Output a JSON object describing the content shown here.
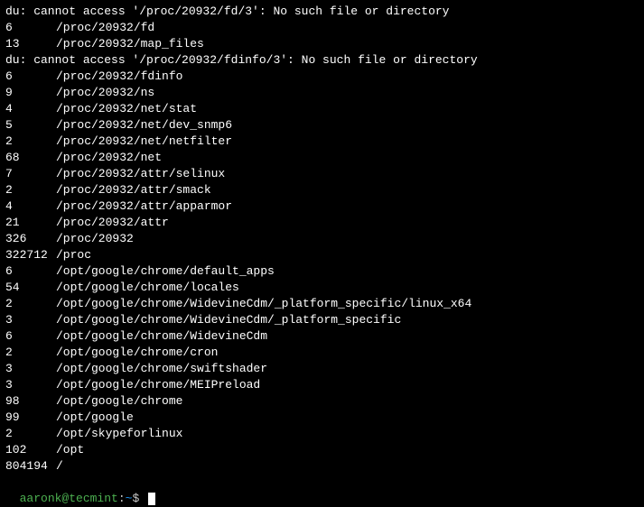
{
  "lines": [
    {
      "type": "error",
      "text": "du: cannot access '/proc/20932/fd/3': No such file or directory"
    },
    {
      "type": "entry",
      "size": "6",
      "path": "/proc/20932/fd"
    },
    {
      "type": "entry",
      "size": "13",
      "path": "/proc/20932/map_files"
    },
    {
      "type": "error",
      "text": "du: cannot access '/proc/20932/fdinfo/3': No such file or directory"
    },
    {
      "type": "entry",
      "size": "6",
      "path": "/proc/20932/fdinfo"
    },
    {
      "type": "entry",
      "size": "9",
      "path": "/proc/20932/ns"
    },
    {
      "type": "entry",
      "size": "4",
      "path": "/proc/20932/net/stat"
    },
    {
      "type": "entry",
      "size": "5",
      "path": "/proc/20932/net/dev_snmp6"
    },
    {
      "type": "entry",
      "size": "2",
      "path": "/proc/20932/net/netfilter"
    },
    {
      "type": "entry",
      "size": "68",
      "path": "/proc/20932/net"
    },
    {
      "type": "entry",
      "size": "7",
      "path": "/proc/20932/attr/selinux"
    },
    {
      "type": "entry",
      "size": "2",
      "path": "/proc/20932/attr/smack"
    },
    {
      "type": "entry",
      "size": "4",
      "path": "/proc/20932/attr/apparmor"
    },
    {
      "type": "entry",
      "size": "21",
      "path": "/proc/20932/attr"
    },
    {
      "type": "entry",
      "size": "326",
      "path": "/proc/20932"
    },
    {
      "type": "entry",
      "size": "322712",
      "path": "/proc"
    },
    {
      "type": "entry",
      "size": "6",
      "path": "/opt/google/chrome/default_apps"
    },
    {
      "type": "entry",
      "size": "54",
      "path": "/opt/google/chrome/locales"
    },
    {
      "type": "entry",
      "size": "2",
      "path": "/opt/google/chrome/WidevineCdm/_platform_specific/linux_x64"
    },
    {
      "type": "entry",
      "size": "3",
      "path": "/opt/google/chrome/WidevineCdm/_platform_specific"
    },
    {
      "type": "entry",
      "size": "6",
      "path": "/opt/google/chrome/WidevineCdm"
    },
    {
      "type": "entry",
      "size": "2",
      "path": "/opt/google/chrome/cron"
    },
    {
      "type": "entry",
      "size": "3",
      "path": "/opt/google/chrome/swiftshader"
    },
    {
      "type": "entry",
      "size": "3",
      "path": "/opt/google/chrome/MEIPreload"
    },
    {
      "type": "entry",
      "size": "98",
      "path": "/opt/google/chrome"
    },
    {
      "type": "entry",
      "size": "99",
      "path": "/opt/google"
    },
    {
      "type": "entry",
      "size": "2",
      "path": "/opt/skypeforlinux"
    },
    {
      "type": "entry",
      "size": "102",
      "path": "/opt"
    },
    {
      "type": "entry",
      "size": "804194",
      "path": "/"
    }
  ],
  "prompt": {
    "user_host": "aaronk@tecmint",
    "colon": ":",
    "path": "~",
    "dollar": "$ "
  }
}
